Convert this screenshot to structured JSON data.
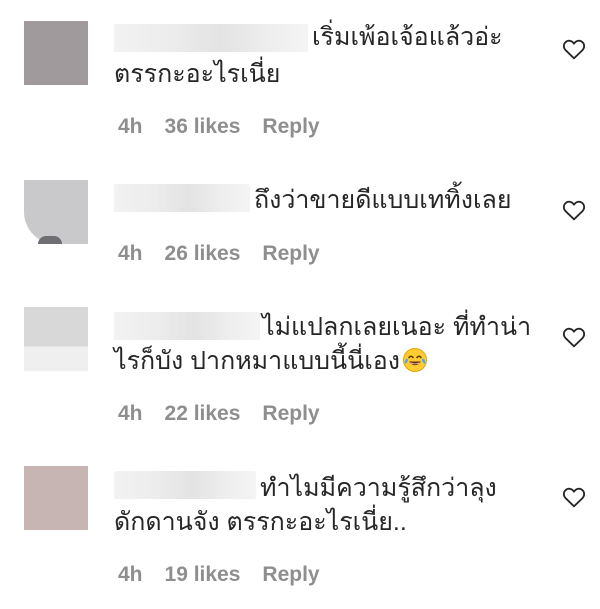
{
  "comments": [
    {
      "text_lines": [
        "เริ่มเพ้อเจ้อแล้วอ่ะ",
        "ตรรกะอะไรเนี่ย"
      ],
      "time": "4h",
      "likes": "36 likes",
      "reply": "Reply"
    },
    {
      "text_lines": [
        "ถึงว่าขายดีแบบเททิ้งเลย"
      ],
      "time": "4h",
      "likes": "26 likes",
      "reply": "Reply"
    },
    {
      "text_lines": [
        "ไม่แปลกเลยเนอะ ที่ทำน่า",
        "ไรก็บัง ปากหมาแบบนี้นี่เอง"
      ],
      "emoji": "face-with-tears-of-joy-icon",
      "time": "4h",
      "likes": "22 likes",
      "reply": "Reply"
    },
    {
      "text_lines": [
        "ทำไมมีความรู้สึกว่าลุง",
        "ดักดานจัง ตรรกะอะไรเนี่ย.."
      ],
      "time": "4h",
      "likes": "19 likes",
      "reply": "Reply"
    }
  ],
  "icons": {
    "like": "heart-outline-icon"
  },
  "colors": {
    "text": "#262626",
    "meta": "#8e8e8e",
    "background": "#ffffff"
  }
}
